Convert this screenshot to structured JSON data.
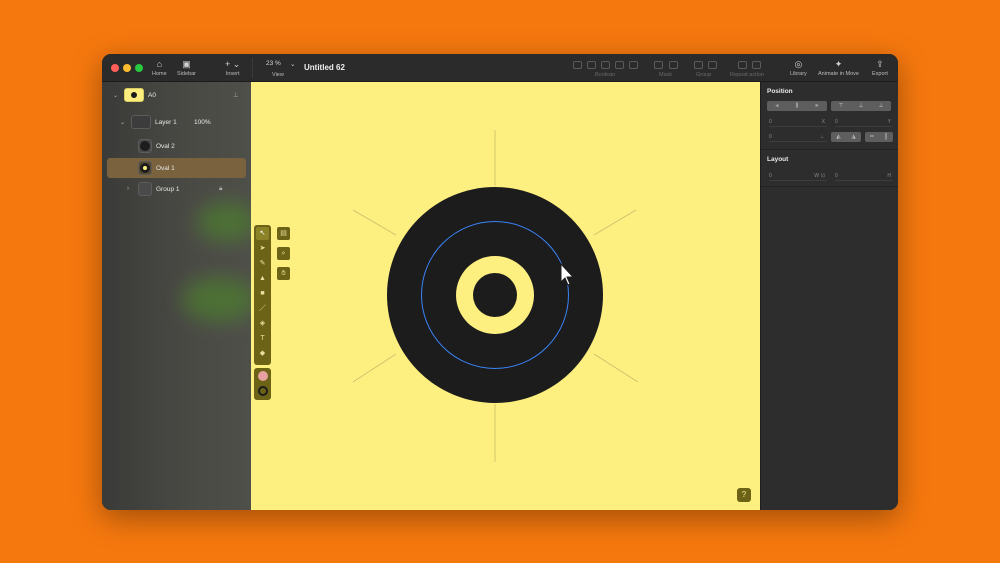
{
  "toolbar": {
    "home_label": "Home",
    "sidebar_label": "Sidebar",
    "insert_label": "Insert",
    "zoom_value": "23 %",
    "view_label": "View",
    "document_title": "Untitled 62",
    "boolean_label": "Boolean",
    "mask_label": "Mask",
    "group_label": "Group",
    "repeat_label": "Repeat action",
    "library_label": "Library",
    "animate_label": "Animate in Move",
    "export_label": "Export"
  },
  "layers": {
    "artboard": "A0",
    "layer1": "Layer 1",
    "layer1_opacity": "100%",
    "oval2": "Oval 2",
    "oval1": "Oval 1",
    "group1": "Group 1"
  },
  "inspector": {
    "position_title": "Position",
    "layout_title": "Layout",
    "x_value": "0",
    "x_unit": "X",
    "y_value": "0",
    "y_unit": "Y",
    "rotation_value": "0",
    "w_value": "0",
    "w_unit": "W",
    "h_value": "0",
    "h_unit": "H"
  },
  "canvas": {
    "help": "?",
    "background_color": "#fdef80",
    "outer_ring_color": "#1c1c1c",
    "selection_color": "#3b82f6"
  },
  "colors": {
    "background": "#f5780e",
    "window": "#2a2a2a",
    "selected_row": "#7a623f",
    "palette": "#6d6316"
  },
  "icons": [
    "home-icon",
    "sidebar-icon",
    "plus-icon",
    "library-icon",
    "animate-icon",
    "export-icon",
    "select-icon",
    "direct-select-icon",
    "pen-icon",
    "vector-icon",
    "shape-icon",
    "line-icon",
    "fill-icon",
    "text-icon",
    "eraser-icon",
    "zoom-icon",
    "hand-icon",
    "help-icon",
    "lock-icon"
  ]
}
